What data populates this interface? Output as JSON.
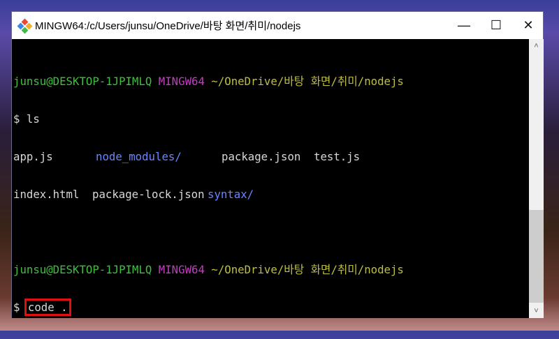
{
  "window": {
    "title": "MINGW64:/c/Users/junsu/OneDrive/바탕 화면/취미/nodejs",
    "icon": "git-bash-icon"
  },
  "controls": {
    "minimize": "—",
    "maximize": "☐",
    "close": "✕"
  },
  "terminal": {
    "prompt1": {
      "user": "junsu@DESKTOP-1JPIMLQ",
      "env": "MINGW64",
      "path": "~/OneDrive/바탕 화면/취미/nodejs"
    },
    "cmd1": "$ ls",
    "ls_row1": [
      "app.js",
      "node_modules/",
      "package.json",
      "test.js"
    ],
    "ls_row2": [
      "index.html",
      "package-lock.json",
      "syntax/"
    ],
    "prompt2": {
      "user": "junsu@DESKTOP-1JPIMLQ",
      "env": "MINGW64",
      "path": "~/OneDrive/바탕 화면/취미/nodejs"
    },
    "cmd2_symbol": "$",
    "cmd2": "code ."
  },
  "scrollbar": {
    "up": "˄",
    "down": "˅",
    "position_fraction": 1.0
  }
}
